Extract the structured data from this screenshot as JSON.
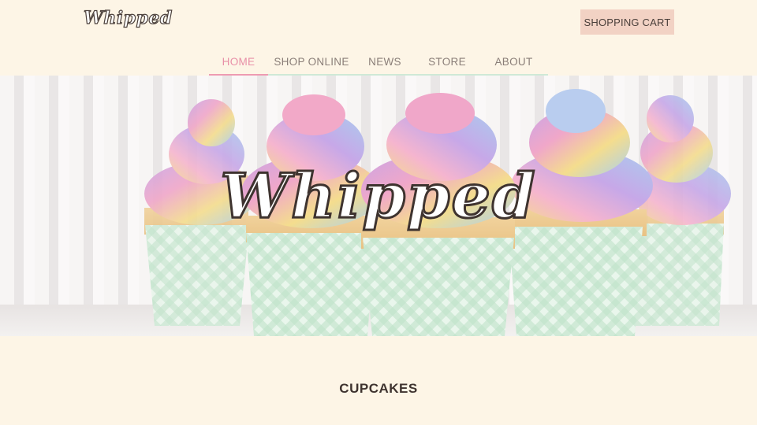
{
  "brand": {
    "logo_text": "Whipped"
  },
  "header": {
    "cart_label": "SHOPPING CART"
  },
  "nav": {
    "items": [
      {
        "label": "HOME",
        "active": true
      },
      {
        "label": "SHOP ONLINE",
        "active": false
      },
      {
        "label": "NEWS",
        "active": false
      },
      {
        "label": "STORE",
        "active": false
      },
      {
        "label": "ABOUT",
        "active": false
      }
    ]
  },
  "hero": {
    "title": "Whipped",
    "image": "pastel-rainbow-cupcakes"
  },
  "section": {
    "title": "CUPCAKES"
  },
  "colors": {
    "background": "#fdf5e6",
    "accent_pink": "#ee9bb2",
    "accent_mint": "#cfe9d6",
    "cart_bg": "#f2d2c4",
    "text": "#4a3f3a"
  }
}
